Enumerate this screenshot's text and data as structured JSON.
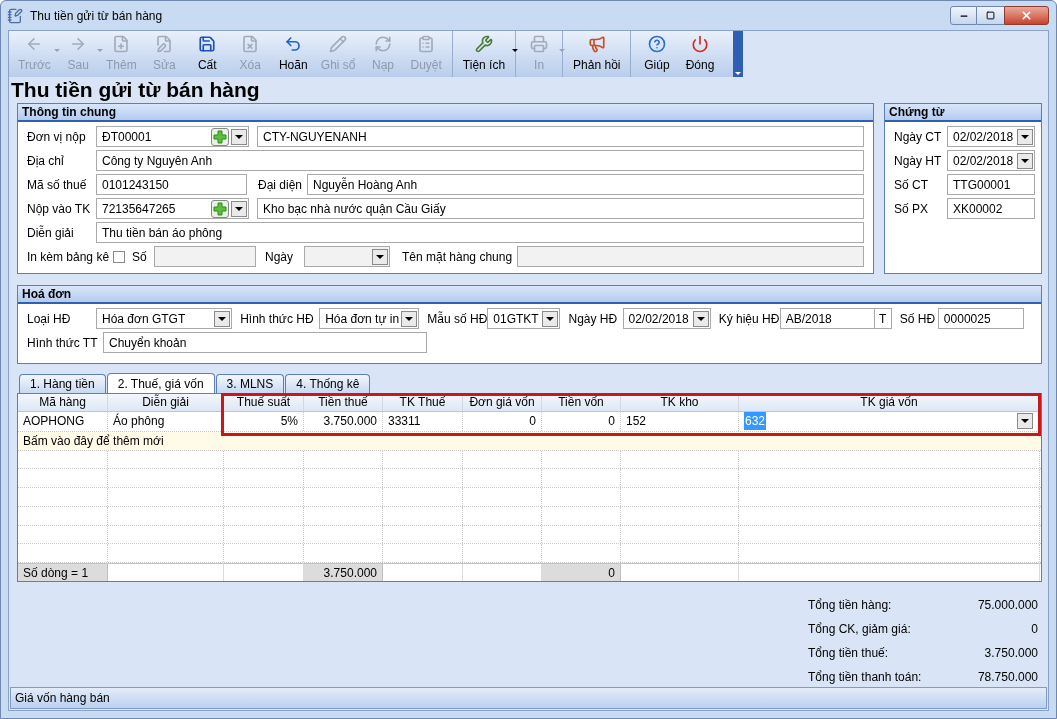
{
  "window": {
    "title": "Thu tiền gửi từ bán hàng"
  },
  "toolbar": [
    {
      "label": "Trước",
      "kind": "back",
      "enabled": false,
      "dropdown": true
    },
    {
      "label": "Sau",
      "kind": "forward",
      "enabled": false,
      "dropdown": true
    },
    {
      "label": "Thêm",
      "kind": "add",
      "enabled": false
    },
    {
      "label": "Sửa",
      "kind": "edit",
      "enabled": false
    },
    {
      "label": "Cất",
      "kind": "save",
      "enabled": true
    },
    {
      "label": "Xóa",
      "kind": "delete",
      "enabled": false
    },
    {
      "label": "Hoãn",
      "kind": "undo",
      "enabled": true
    },
    {
      "label": "Ghi sổ",
      "kind": "post",
      "enabled": false
    },
    {
      "label": "Nạp",
      "kind": "reload",
      "enabled": false
    },
    {
      "label": "Duyệt",
      "kind": "approve",
      "enabled": false,
      "separator": true
    },
    {
      "label": "Tiện ích",
      "kind": "tools",
      "enabled": true,
      "dropdown": true,
      "separator": true
    },
    {
      "label": "In",
      "kind": "print",
      "enabled": false,
      "dropdown": true,
      "separator": true
    },
    {
      "label": "Phản hồi",
      "kind": "feedback",
      "enabled": true,
      "separator": true
    },
    {
      "label": "Giúp",
      "kind": "help",
      "enabled": true
    },
    {
      "label": "Đóng",
      "kind": "close",
      "enabled": true
    }
  ],
  "heading": "Thu tiền gửi từ bán hàng",
  "general": {
    "title": "Thông tin chung",
    "payer": {
      "label": "Đơn vị nộp",
      "code": "ĐT00001",
      "name": "CTY-NGUYENANH"
    },
    "address": {
      "label": "Địa chỉ",
      "value": "Công ty Nguyên Anh"
    },
    "tax_code": {
      "label": "Mã số thuế",
      "value": "0101243150"
    },
    "representative": {
      "label": "Đại diện",
      "value": "Nguyễn Hoàng Anh"
    },
    "account": {
      "label": "Nộp vào TK",
      "code": "72135647265",
      "name": "Kho bạc nhà nước quận Cầu Giấy"
    },
    "description": {
      "label": "Diễn giải",
      "value": "Thu tiền bán áo phông"
    },
    "attach_list": {
      "label": "In kèm bảng kê",
      "checked": false
    },
    "number": {
      "label": "Số"
    },
    "date": {
      "label": "Ngày"
    },
    "common_item": {
      "label": "Tên mặt hàng chung"
    }
  },
  "voucher": {
    "title": "Chứng từ",
    "fields": [
      {
        "label": "Ngày CT",
        "value": "02/02/2018",
        "kind": "combo"
      },
      {
        "label": "Ngày HT",
        "value": "02/02/2018",
        "kind": "combo"
      },
      {
        "label": "Số CT",
        "value": "TTG00001",
        "kind": "text"
      },
      {
        "label": "Số PX",
        "value": "XK00002",
        "kind": "text"
      }
    ]
  },
  "invoice": {
    "title": "Hoá đơn",
    "fields": [
      {
        "label": "Loại HĐ",
        "value": "Hóa đơn GTGT",
        "kind": "combo"
      },
      {
        "label": "Hình thức HĐ",
        "value": "Hóa đơn tự in",
        "kind": "combo"
      },
      {
        "label": "Mẫu số HĐ",
        "value": "01GTKT",
        "kind": "combo"
      },
      {
        "label": "Ngày HĐ",
        "value": "02/02/2018",
        "kind": "combo"
      },
      {
        "label": "Ký hiệu HĐ",
        "value": "AB/2018",
        "suffix": "T",
        "kind": "text"
      },
      {
        "label": "Số HĐ",
        "value": "0000025",
        "kind": "text"
      }
    ],
    "payment_method": {
      "label": "Hình thức TT",
      "value": "Chuyển khoản"
    }
  },
  "tabs": [
    {
      "label": "1. Hàng tiền",
      "selected": false
    },
    {
      "label": "2. Thuế, giá vốn",
      "selected": true
    },
    {
      "label": "3. MLNS",
      "selected": false
    },
    {
      "label": "4. Thống kê",
      "selected": false
    }
  ],
  "grid": {
    "columns": [
      {
        "label": "Mã hàng",
        "highlighted": false,
        "total": "Số dòng = 1"
      },
      {
        "label": "Diễn giải",
        "highlighted": false
      },
      {
        "label": "Thuế suất",
        "highlighted": true
      },
      {
        "label": "Tiền thuế",
        "highlighted": true,
        "total": "3.750.000"
      },
      {
        "label": "TK Thuế",
        "highlighted": true
      },
      {
        "label": "Đơn giá vốn",
        "highlighted": true
      },
      {
        "label": "Tiền vốn",
        "highlighted": true,
        "total": "0"
      },
      {
        "label": "TK kho",
        "highlighted": true
      },
      {
        "label": "TK giá vốn",
        "highlighted": true
      }
    ],
    "rows": [
      {
        "cells": [
          {
            "text": "AOPHONG",
            "selected": false
          },
          {
            "text": "Áo phông",
            "selected": false
          },
          {
            "text": "5%",
            "selected": false
          },
          {
            "text": "3.750.000",
            "selected": false
          },
          {
            "text": "33311",
            "selected": false
          },
          {
            "text": "0",
            "selected": false
          },
          {
            "text": "0",
            "selected": false
          },
          {
            "text": "152",
            "selected": false
          },
          {
            "text": "632",
            "selected": true
          }
        ]
      }
    ],
    "new_row_hint": "Bấm vào đây để thêm mới"
  },
  "totals": [
    {
      "label": "Tổng tiền hàng:",
      "value": "75.000.000"
    },
    {
      "label": "Tổng CK, giảm giá:",
      "value": "0"
    },
    {
      "label": "Tổng tiền thuế:",
      "value": "3.750.000"
    },
    {
      "label": "Tổng tiền thanh toán:",
      "value": "78.750.000"
    }
  ],
  "status_bar": "Giá vốn hàng bán"
}
